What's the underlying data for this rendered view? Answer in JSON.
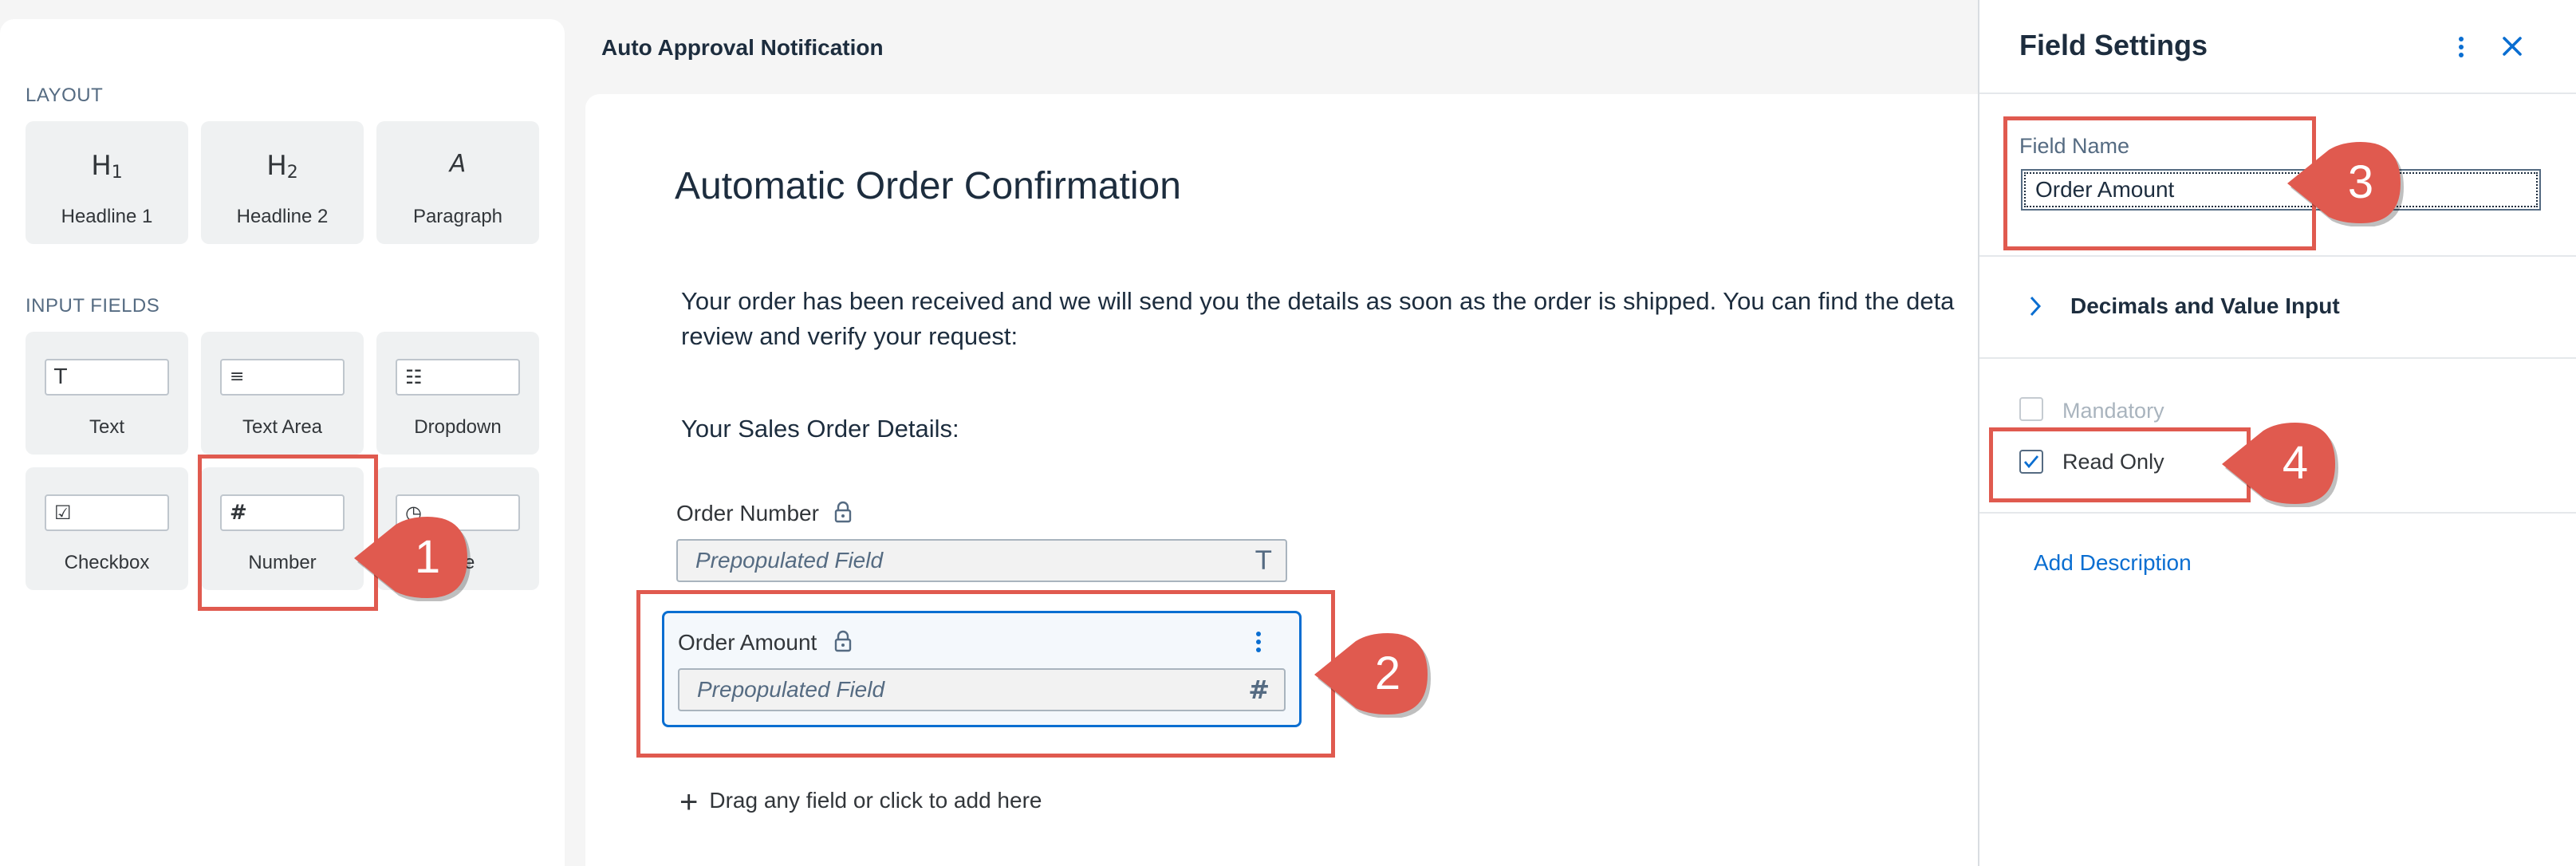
{
  "palette": {
    "layout_label": "LAYOUT",
    "layout_items": [
      {
        "label": "Headline 1",
        "glyph": "H",
        "sub": "1"
      },
      {
        "label": "Headline 2",
        "glyph": "H",
        "sub": "2"
      },
      {
        "label": "Paragraph",
        "glyph": "A"
      }
    ],
    "input_label": "INPUT FIELDS",
    "input_items": [
      {
        "label": "Text",
        "glyph": "T"
      },
      {
        "label": "Text Area",
        "glyph": "≡"
      },
      {
        "label": "Dropdown",
        "glyph": "☷"
      },
      {
        "label": "Checkbox",
        "glyph": "☑"
      },
      {
        "label": "Number",
        "glyph": "#"
      },
      {
        "label": "e",
        "glyph": "◷"
      }
    ]
  },
  "form": {
    "title": "Auto Approval Notification",
    "heading": "Automatic Order Confirmation",
    "paragraph_line1": "Your order has been received and we will send you the details as soon as the order is shipped. You can find the deta",
    "paragraph_line2": "review and verify your request:",
    "details_heading": "Your Sales Order Details:",
    "fields": [
      {
        "label": "Order Number",
        "placeholder": "Prepopulated Field",
        "type_glyph": "T"
      },
      {
        "label": "Order Amount",
        "placeholder": "Prepopulated Field",
        "type_glyph": "#"
      }
    ],
    "add_here": "Drag any field or click to add here"
  },
  "settings": {
    "title": "Field Settings",
    "field_name_label": "Field Name",
    "field_name_value": "Order Amount",
    "decimals_section": "Decimals and Value Input",
    "mandatory_label": "Mandatory",
    "mandatory_checked": false,
    "read_only_label": "Read Only",
    "read_only_checked": true,
    "add_description": "Add Description"
  },
  "callouts": [
    "1",
    "2",
    "3",
    "4"
  ],
  "colors": {
    "accent": "#0a6ed1",
    "callout": "#e05a4f"
  }
}
